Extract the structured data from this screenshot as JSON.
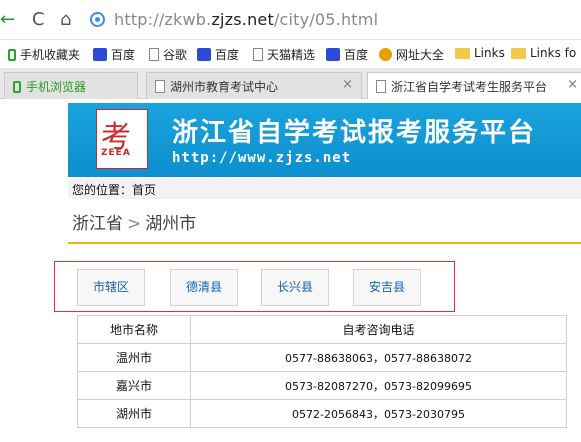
{
  "browser": {
    "url_prefix": "http://zkwb.",
    "url_domain": "zjzs.net",
    "url_suffix": "/city/05.html",
    "back_icon": "←",
    "reload_icon": "C",
    "home_icon": "⌂"
  },
  "bookmarks": [
    {
      "label": "手机收藏夹",
      "icon": "phone-icon"
    },
    {
      "label": "百度",
      "icon": "baidu-paw-icon"
    },
    {
      "label": "谷歌",
      "icon": "page-icon"
    },
    {
      "label": "百度",
      "icon": "baidu-paw-icon"
    },
    {
      "label": "天猫精选",
      "icon": "page-icon"
    },
    {
      "label": "百度",
      "icon": "baidu-paw-icon"
    },
    {
      "label": "网址大全",
      "icon": "globe-icon"
    },
    {
      "label": "Links",
      "icon": "folder-icon"
    },
    {
      "label": "Links fo",
      "icon": "folder-icon"
    }
  ],
  "tabs": [
    {
      "label": "手机浏览器",
      "active": false
    },
    {
      "label": "湖州市教育考试中心",
      "active": false,
      "close": "×"
    },
    {
      "label": "浙江省自学考试考生服务平台",
      "active": true,
      "close": "×"
    }
  ],
  "banner": {
    "title": "浙江省自学考试报考服务平台",
    "url": "http://www.zjzs.net",
    "logo_mark": "考",
    "logo_abbr": "ZEEA"
  },
  "breadcrumb": {
    "prefix": "您的位置：",
    "home": "首页"
  },
  "region": {
    "province": "浙江省",
    "separator": ">",
    "city": "湖州市"
  },
  "counties": [
    "市辖区",
    "德清县",
    "长兴县",
    "安吉县"
  ],
  "phone_table": {
    "headers": [
      "地市名称",
      "自考咨询电话"
    ],
    "rows": [
      [
        "温州市",
        "0577-88638063，0577-88638072"
      ],
      [
        "嘉兴市",
        "0573-82087270，0573-82099695"
      ],
      [
        "湖州市",
        "0572-2056843，0573-2030795"
      ]
    ]
  },
  "colors": {
    "banner_blue": "#1aa3dc",
    "divider_gold": "#e8b11b",
    "highlight_red": "#e0352f",
    "link_blue": "#1560b0"
  }
}
